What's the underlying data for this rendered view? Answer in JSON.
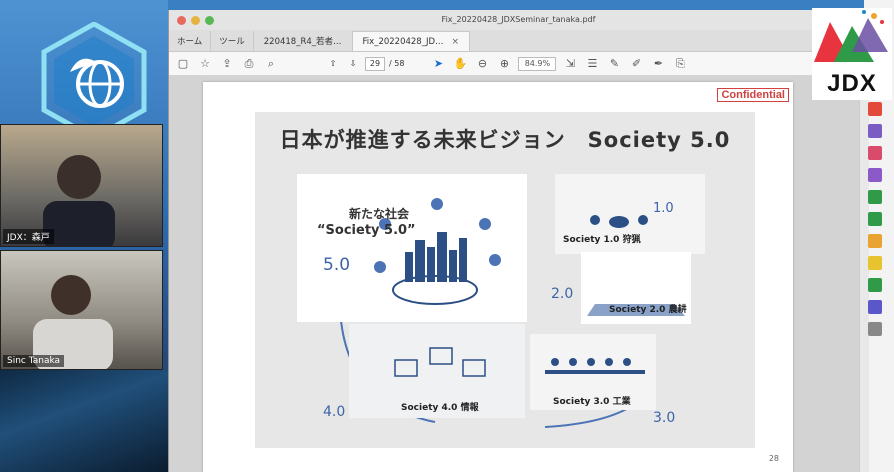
{
  "window": {
    "doc_title": "Fix_20220428_JDXSeminar_tanaka.pdf"
  },
  "tabs": [
    {
      "label": "ホーム"
    },
    {
      "label": "ツール"
    },
    {
      "label": "220418_R4_若者…"
    },
    {
      "label": "Fix_20220428_JD…"
    }
  ],
  "toolbar": {
    "page_current": "29",
    "page_total": "/ 58",
    "zoom": "84.9%"
  },
  "page": {
    "confidential": "Confidential",
    "slide_title": "日本が推進する未来ビジョン　Society 5.0",
    "center_heading": "新たな社会",
    "center_heading2": "“Society 5.0”",
    "labels": {
      "s50": "5.0",
      "s40": "4.0",
      "s30": "3.0",
      "s20": "2.0",
      "s10": "1.0",
      "society1": "Society 1.0 狩猟",
      "society2": "Society 2.0 農耕",
      "society3": "Society 3.0 工業",
      "society4": "Society 4.0 情報"
    },
    "number": "28"
  },
  "videos": [
    {
      "name": "JDX：森戸"
    },
    {
      "name": "Sinc Tanaka"
    }
  ],
  "brand": {
    "jdx": "JDX"
  }
}
